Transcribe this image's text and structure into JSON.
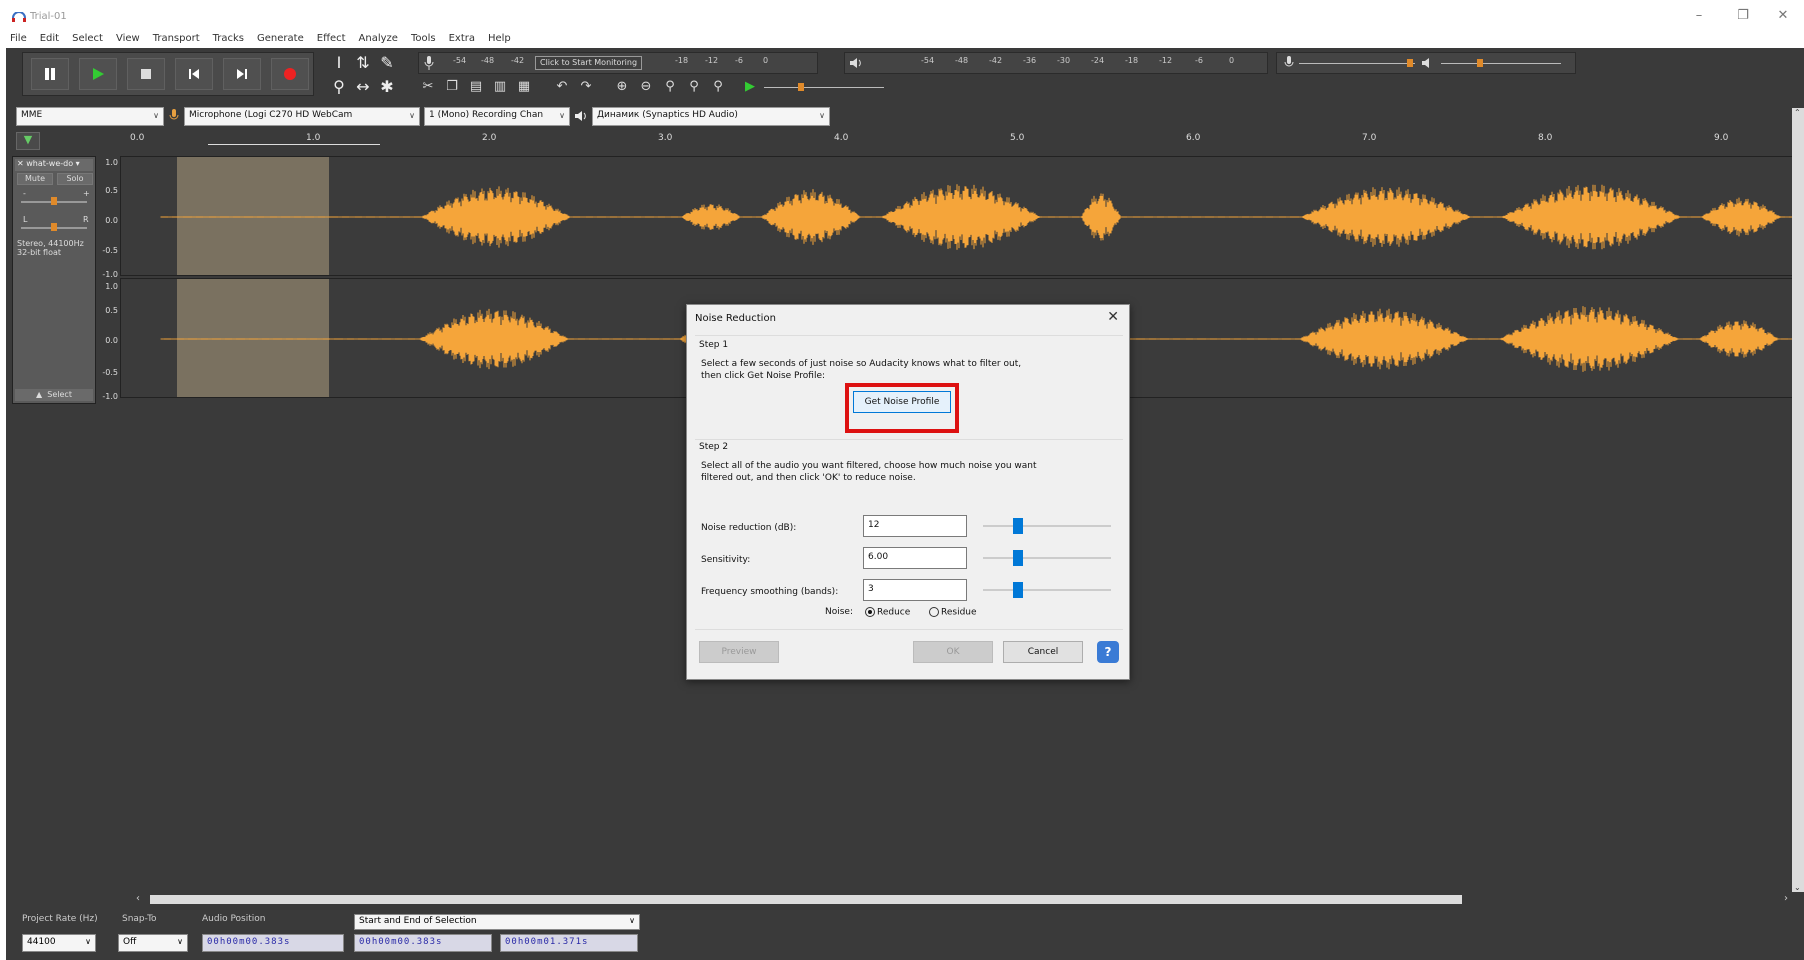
{
  "window": {
    "title": "Trial-01",
    "icon": "headphones-icon",
    "controls": [
      "–",
      "❐",
      "✕"
    ]
  },
  "menu": [
    "File",
    "Edit",
    "Select",
    "View",
    "Transport",
    "Tracks",
    "Generate",
    "Effect",
    "Analyze",
    "Tools",
    "Extra",
    "Help"
  ],
  "toolbar": {
    "monitor_label": "Click to Start Monitoring",
    "record_meter_ticks": [
      "-54",
      "-48",
      "-42",
      "",
      "-18",
      "-12",
      "-6",
      "0"
    ],
    "play_meter_ticks": [
      "-54",
      "-48",
      "-42",
      "-36",
      "-30",
      "-24",
      "-18",
      "-12",
      "-6",
      "0"
    ]
  },
  "devices": {
    "host": "MME",
    "recording_device": "Microphone (Logi C270 HD WebCam",
    "channels": "1 (Mono) Recording Chan",
    "playback_device": "Динамик (Synaptics HD Audio)"
  },
  "ruler": {
    "ticks": [
      "0.0",
      "1.0",
      "2.0",
      "3.0",
      "4.0",
      "5.0",
      "6.0",
      "7.0",
      "8.0",
      "9.0"
    ]
  },
  "track": {
    "name": "what-we-do",
    "mute": "Mute",
    "solo": "Solo",
    "gain_minus": "-",
    "gain_plus": "+",
    "pan_left": "L",
    "pan_right": "R",
    "info_line1": "Stereo, 44100Hz",
    "info_line2": "32-bit float",
    "select": "Select",
    "scale": [
      "1.0",
      "0.5",
      "0.0",
      "-0.5",
      "-1.0"
    ],
    "wave_color": "#f5a53a"
  },
  "dialog": {
    "title": "Noise Reduction",
    "step1_label": "Step 1",
    "step1_text1": "Select a few seconds of just noise so Audacity knows what to filter out,",
    "step1_text2": "then click Get Noise Profile:",
    "get_profile": "Get Noise Profile",
    "step2_label": "Step 2",
    "step2_text1": "Select all of the audio you want filtered, choose how much noise you want",
    "step2_text2": "filtered out, and then click 'OK' to reduce noise.",
    "noise_reduction_label": "Noise reduction (dB):",
    "noise_reduction_value": "12",
    "sensitivity_label": "Sensitivity:",
    "sensitivity_value": "6.00",
    "smoothing_label": "Frequency smoothing (bands):",
    "smoothing_value": "3",
    "noise_label": "Noise:",
    "reduce": "Reduce",
    "residue": "Residue",
    "preview": "Preview",
    "ok": "OK",
    "cancel": "Cancel",
    "help": "?"
  },
  "status": {
    "project_rate_label": "Project Rate (Hz)",
    "project_rate": "44100",
    "snap_label": "Snap-To",
    "snap": "Off",
    "audio_position_label": "Audio Position",
    "audio_position": "00h00m00.383s",
    "selection_mode": "Start and End of Selection",
    "sel_start": "00h00m00.383s",
    "sel_end": "00h00m01.371s"
  }
}
